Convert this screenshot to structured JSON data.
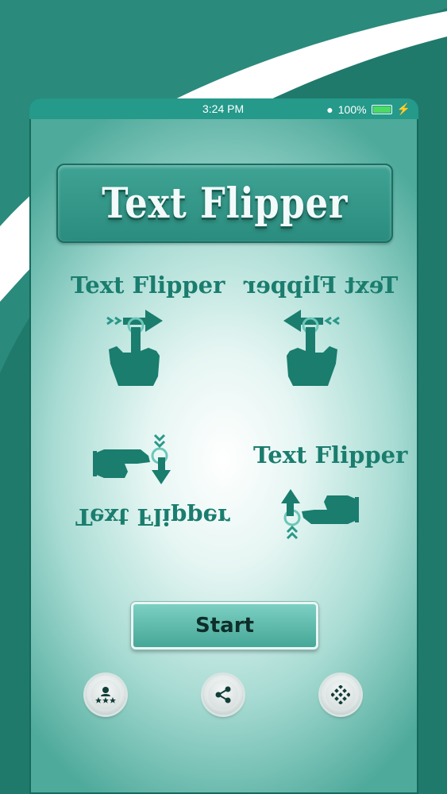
{
  "status_bar": {
    "time": "3:24 PM",
    "battery_percent": "100%"
  },
  "app": {
    "title": "Text Flipper"
  },
  "demos": [
    {
      "label": "Text Flipper",
      "direction": "right"
    },
    {
      "label": "Text Flipper",
      "direction": "left"
    },
    {
      "label": "Text Flipper",
      "direction": "down"
    },
    {
      "label": "Text Flipper",
      "direction": "up"
    }
  ],
  "start_button": {
    "label": "Start"
  },
  "bottom_bar": {
    "rate_icon": "rate-apps-icon",
    "share_icon": "share-icon",
    "more_icon": "more-apps-icon"
  },
  "colors": {
    "brand": "#1f7a6c",
    "accent": "#25998a",
    "text": "#1a7d6e"
  }
}
